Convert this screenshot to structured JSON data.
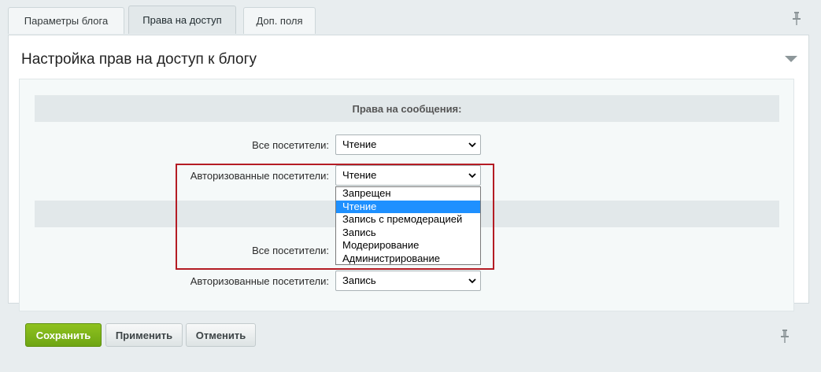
{
  "tabs": [
    {
      "label": "Параметры блога",
      "active": false
    },
    {
      "label": "Права на доступ",
      "active": true
    },
    {
      "label": "Доп. поля",
      "active": false
    }
  ],
  "panel": {
    "title": "Настройка прав на доступ к блогу"
  },
  "sections": [
    {
      "header": "Права на сообщения:",
      "rows": [
        {
          "label": "Все посетители:",
          "value": "Чтение"
        },
        {
          "label": "Авторизованные посетители:",
          "value": "Чтение"
        }
      ]
    },
    {
      "header": "",
      "rows": [
        {
          "label": "Все посетители:",
          "value": ""
        },
        {
          "label": "Авторизованные посетители:",
          "value": "Запись"
        }
      ]
    }
  ],
  "dropdown": {
    "options": [
      "Запрещен",
      "Чтение",
      "Запись с премодерацией",
      "Запись",
      "Модерирование",
      "Администрирование"
    ],
    "selected": "Чтение"
  },
  "buttons": {
    "save": "Сохранить",
    "apply": "Применить",
    "cancel": "Отменить"
  },
  "colors": {
    "highlight": "#b41c24",
    "selected_option": "#1e90ff",
    "save_button": "#7cb518"
  }
}
